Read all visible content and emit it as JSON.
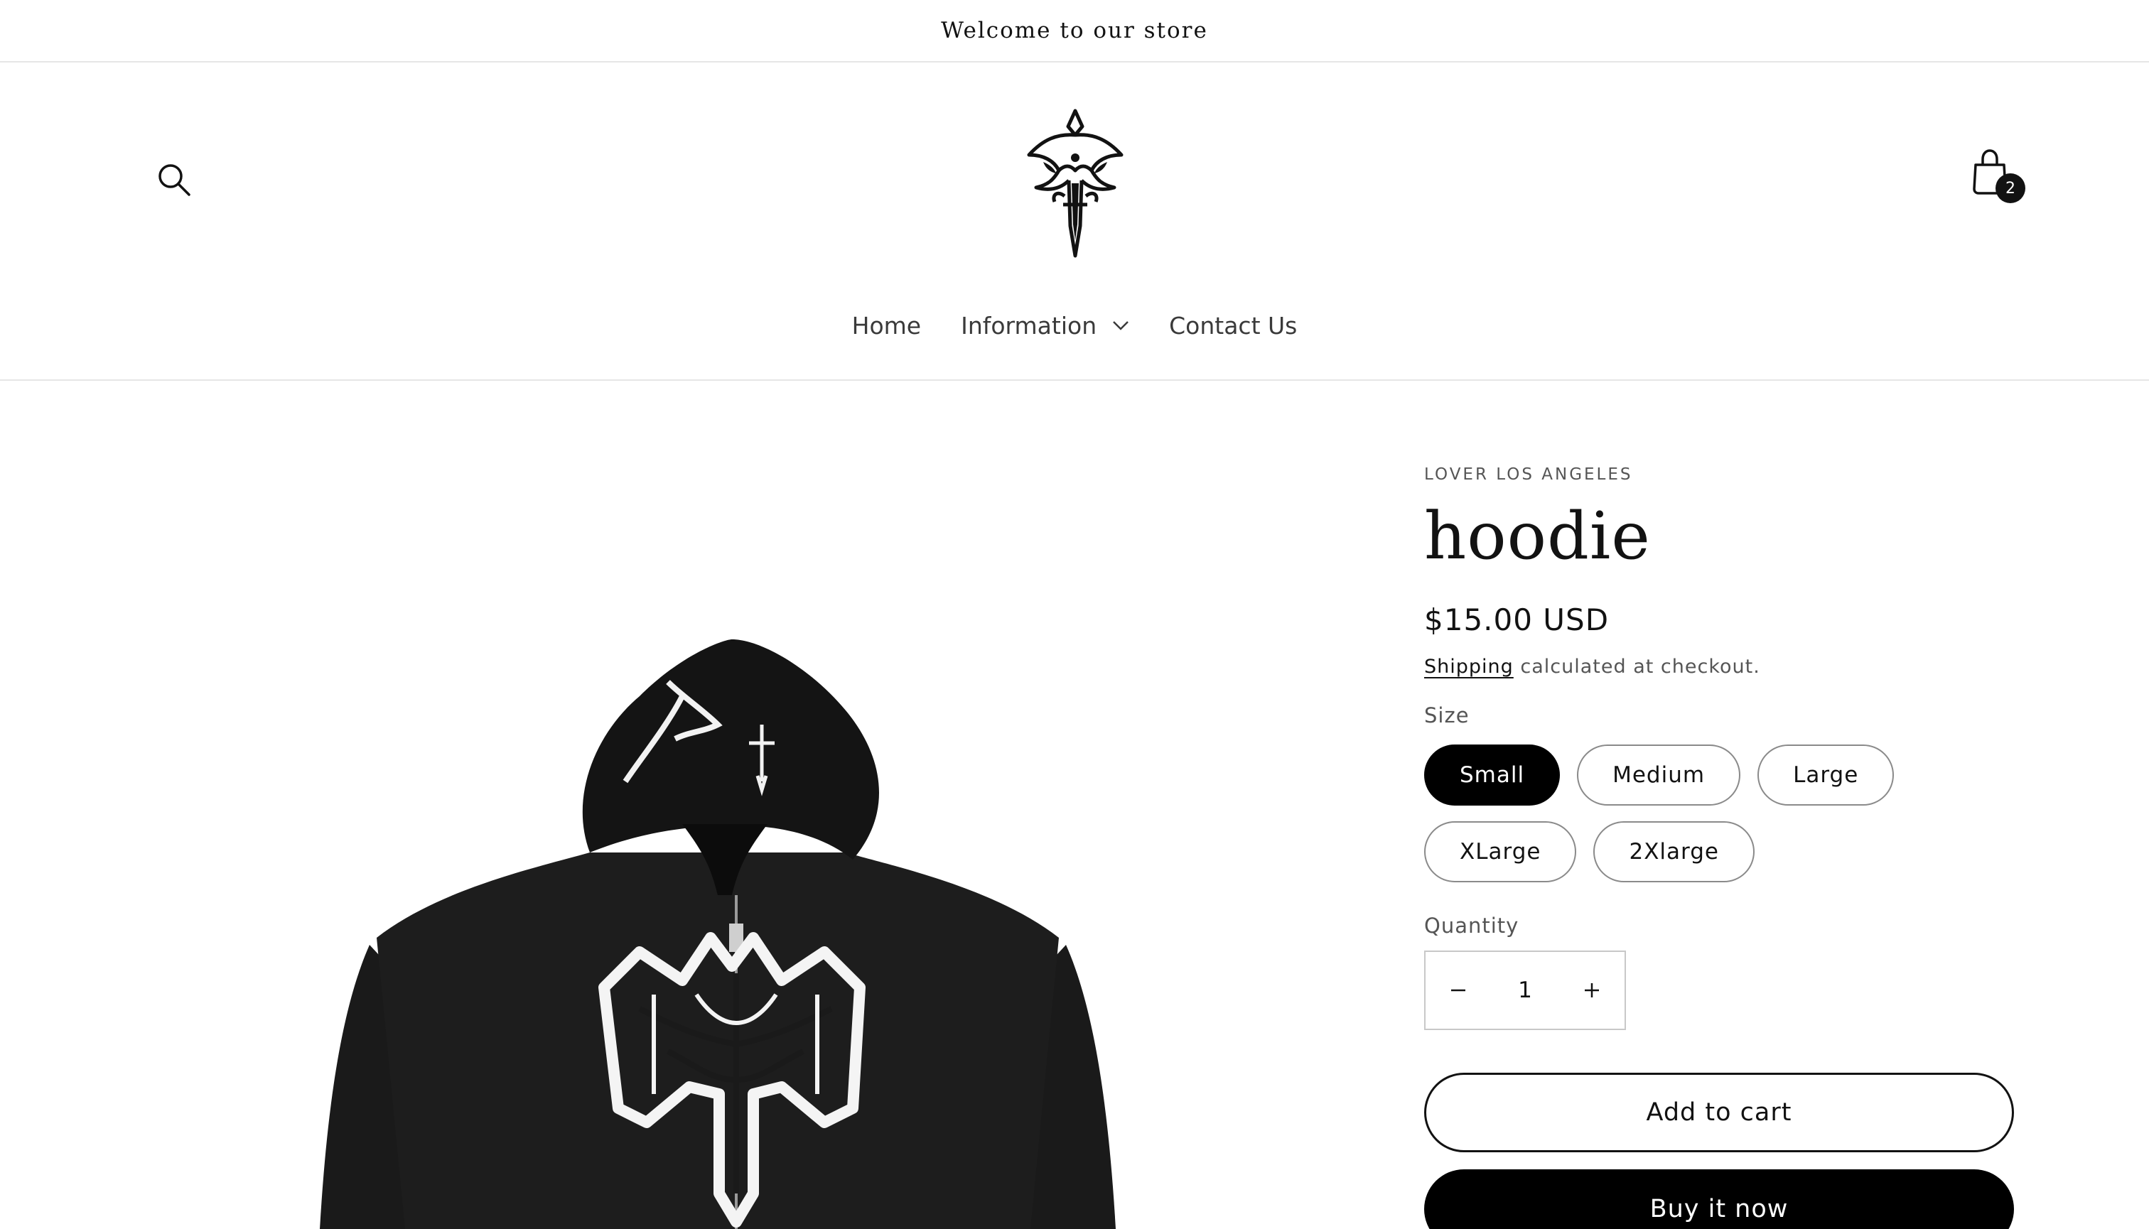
{
  "announcement": {
    "text": "Welcome to our store"
  },
  "header": {
    "search_icon": "search-icon",
    "logo_icon": "gothic-cross-logo",
    "cart_icon": "shopping-bag-icon",
    "cart_count": "2"
  },
  "nav": {
    "items": [
      {
        "label": "Home"
      },
      {
        "label": "Information",
        "icon": "chevron-down-icon"
      },
      {
        "label": "Contact Us"
      }
    ]
  },
  "product": {
    "vendor": "LOVER LOS ANGELES",
    "title": "hoodie",
    "price": "$15.00 USD",
    "shipping_link": "Shipping",
    "shipping_note": " calculated at checkout.",
    "size_label": "Size",
    "sizes": [
      {
        "label": "Small",
        "selected": true
      },
      {
        "label": "Medium",
        "selected": false
      },
      {
        "label": "Large",
        "selected": false
      },
      {
        "label": "XLarge",
        "selected": false
      },
      {
        "label": "2Xlarge",
        "selected": false
      }
    ],
    "quantity_label": "Quantity",
    "quantity_value": "1",
    "add_to_cart": "Add to cart",
    "buy_now": "Buy it now",
    "image_icon": "black-zip-hoodie-with-gothic-cross-graphic"
  },
  "colors": {
    "text": "#121212",
    "muted": "#555555",
    "border": "#e6e6e6",
    "button_dark": "#000000",
    "hoodie": "#1a1a1a"
  }
}
